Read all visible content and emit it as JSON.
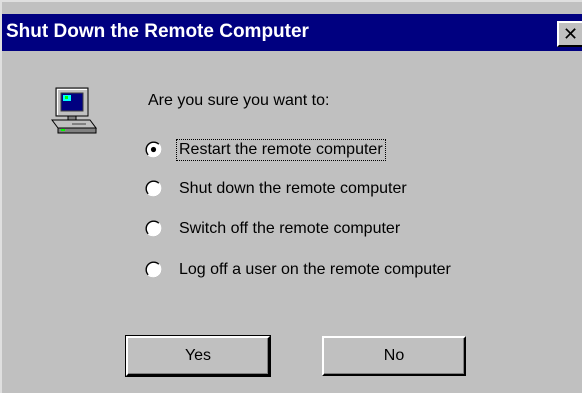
{
  "window": {
    "title": "Shut Down the Remote Computer",
    "close_glyph": "✕"
  },
  "icons": {
    "computer": "computer-icon",
    "close": "close-icon"
  },
  "dialog": {
    "prompt": "Are you sure you want to:",
    "options": [
      {
        "label": "Restart the remote computer",
        "selected": true
      },
      {
        "label": "Shut down the remote computer",
        "selected": false
      },
      {
        "label": "Switch off the remote computer",
        "selected": false
      },
      {
        "label": "Log off a user on the remote computer",
        "selected": false
      }
    ],
    "buttons": {
      "yes": "Yes",
      "no": "No"
    }
  },
  "colors": {
    "titlebar": "#000080",
    "face": "#c0c0c0",
    "title_text": "#ffffff"
  }
}
